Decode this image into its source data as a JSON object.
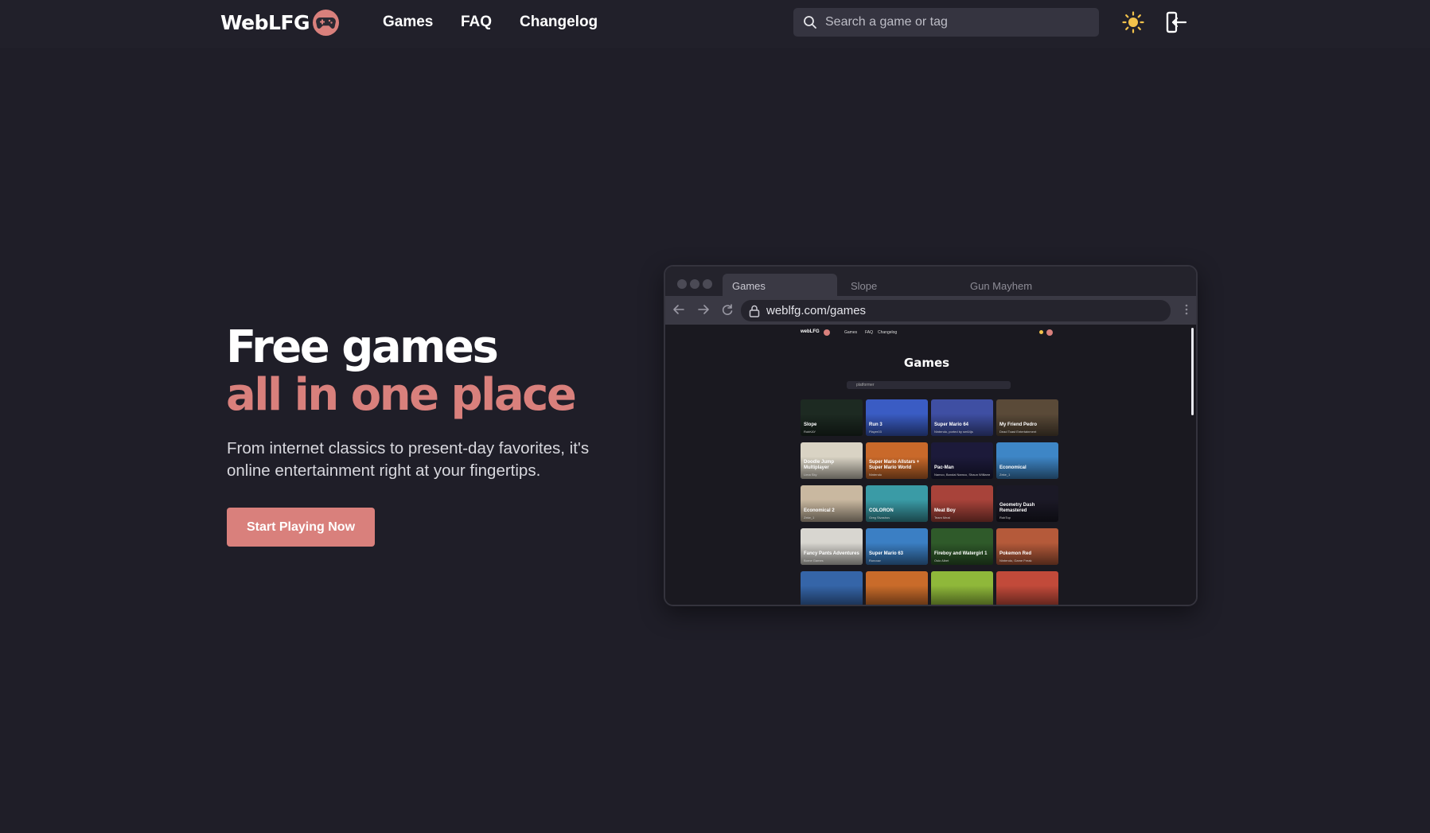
{
  "brand": {
    "name": "WebLFG",
    "accent": "#d9807c"
  },
  "nav": {
    "links": [
      "Games",
      "FAQ",
      "Changelog"
    ],
    "search_placeholder": "Search a game or tag"
  },
  "hero": {
    "title_line1": "Free games",
    "title_line2": "all in one place",
    "subtitle": "From internet classics to present-day favorites, it's online entertainment right at your fingertips.",
    "cta_label": "Start Playing Now"
  },
  "preview": {
    "tabs": [
      "Games",
      "Slope",
      "Gun Mayhem"
    ],
    "url": "weblfg.com/games",
    "mini_nav": {
      "logo": "webLFG",
      "links": [
        "Games",
        "FAQ",
        "Changelog"
      ]
    },
    "page_title": "Games",
    "search_text": "platformer",
    "cards": [
      {
        "title": "Slope",
        "author": "RobKAY",
        "color": "#1d2a22"
      },
      {
        "title": "Run 3",
        "author": "Player03",
        "color": "#3a5cc4"
      },
      {
        "title": "Super Mario 64",
        "author": "Nintendo, ported by sm64js",
        "color": "#3f4fa3"
      },
      {
        "title": "My Friend Pedro",
        "author": "Dead Toast Entertainment",
        "color": "#5a4a38"
      },
      {
        "title": "Doodle Jump Multiplayer",
        "author": "Lima Sky",
        "color": "#d9d3c4"
      },
      {
        "title": "Super Mario Allstars + Super Mario World",
        "author": "Nintendo",
        "color": "#c9692a"
      },
      {
        "title": "Pac-Man",
        "author": "Namco, Bandai Namco, Shaun Williams",
        "color": "#1c1a3a"
      },
      {
        "title": "Economical",
        "author": "Zeke_1",
        "color": "#3e86c6"
      },
      {
        "title": "Economical 2",
        "author": "Zeke_1",
        "color": "#c9b8a0"
      },
      {
        "title": "COLORON",
        "author": "Greg Sivashov",
        "color": "#3a9ba6"
      },
      {
        "title": "Meat Boy",
        "author": "Team Meat",
        "color": "#a8433a"
      },
      {
        "title": "Geometry Dash Remastered",
        "author": "RobTop",
        "color": "#1b1926"
      },
      {
        "title": "Fancy Pants Adventures",
        "author": "Borne Games",
        "color": "#d8d6d0"
      },
      {
        "title": "Super Mario 63",
        "author": "Runouw",
        "color": "#3b7fc4"
      },
      {
        "title": "Fireboy and Watergirl 1",
        "author": "Oslo Albet",
        "color": "#2f5a2a"
      },
      {
        "title": "Pokemon Red",
        "author": "Nintendo, Game Freak",
        "color": "#b55a3a"
      },
      {
        "title": "",
        "author": "",
        "color": "#3565a8"
      },
      {
        "title": "",
        "author": "",
        "color": "#c96b2a"
      },
      {
        "title": "",
        "author": "",
        "color": "#8fb83a"
      },
      {
        "title": "",
        "author": "",
        "color": "#c24a3a"
      }
    ]
  }
}
